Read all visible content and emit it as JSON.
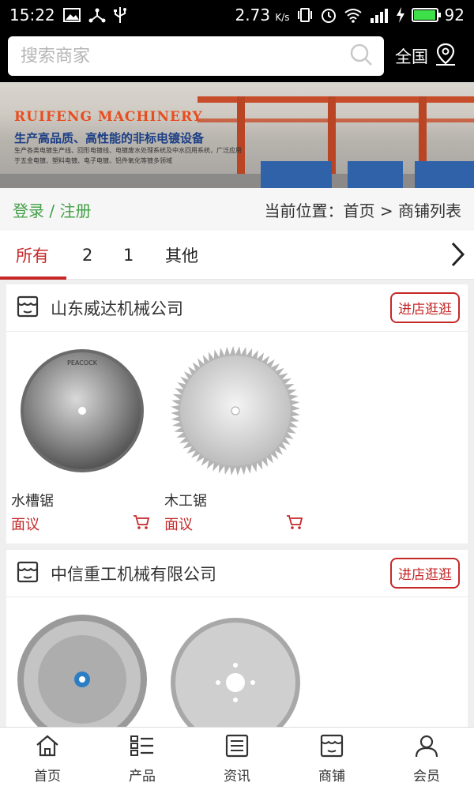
{
  "status_bar": {
    "time": "15:22",
    "speed": "2.73",
    "speed_unit": "K/s",
    "battery": "92",
    "battery_level": 0.92
  },
  "search": {
    "placeholder": "搜索商家",
    "region_label": "全国"
  },
  "banner": {
    "brand": "RUIFENG MACHINERY",
    "tagline": "生产高品质、高性能的非标电镀设备",
    "description": "生产各类电镀生产线、回形电镀线、电镀废水处理系统及中水回用系统，广泛应用于五金电镀、塑料电镀、电子电镀、铝件氧化等镀多领域"
  },
  "breadcrumb": {
    "login": "登录",
    "separator": "/",
    "register": "注册",
    "location": "当前位置：首页 > 商铺列表"
  },
  "tabs": [
    {
      "label": "所有",
      "active": true
    },
    {
      "label": "2",
      "active": false
    },
    {
      "label": "1",
      "active": false
    },
    {
      "label": "其他",
      "active": false
    }
  ],
  "shops": [
    {
      "name": "山东威达机械公司",
      "visit_label": "进店逛逛",
      "products": [
        {
          "name": "水槽锯",
          "price": "面议"
        },
        {
          "name": "木工锯",
          "price": "面议"
        }
      ]
    },
    {
      "name": "中信重工机械有限公司",
      "visit_label": "进店逛逛",
      "products": [
        {
          "name": "",
          "price": ""
        },
        {
          "name": "",
          "price": ""
        }
      ]
    }
  ],
  "product_image_text": "PEACOCK",
  "bottom_nav": [
    {
      "label": "首页",
      "icon": "home-icon"
    },
    {
      "label": "产品",
      "icon": "list-icon"
    },
    {
      "label": "资讯",
      "icon": "news-icon"
    },
    {
      "label": "商铺",
      "icon": "store-icon"
    },
    {
      "label": "会员",
      "icon": "user-icon"
    }
  ],
  "colors": {
    "accent": "#c62828",
    "auth_link": "#43a047",
    "header_bg": "#000000"
  }
}
